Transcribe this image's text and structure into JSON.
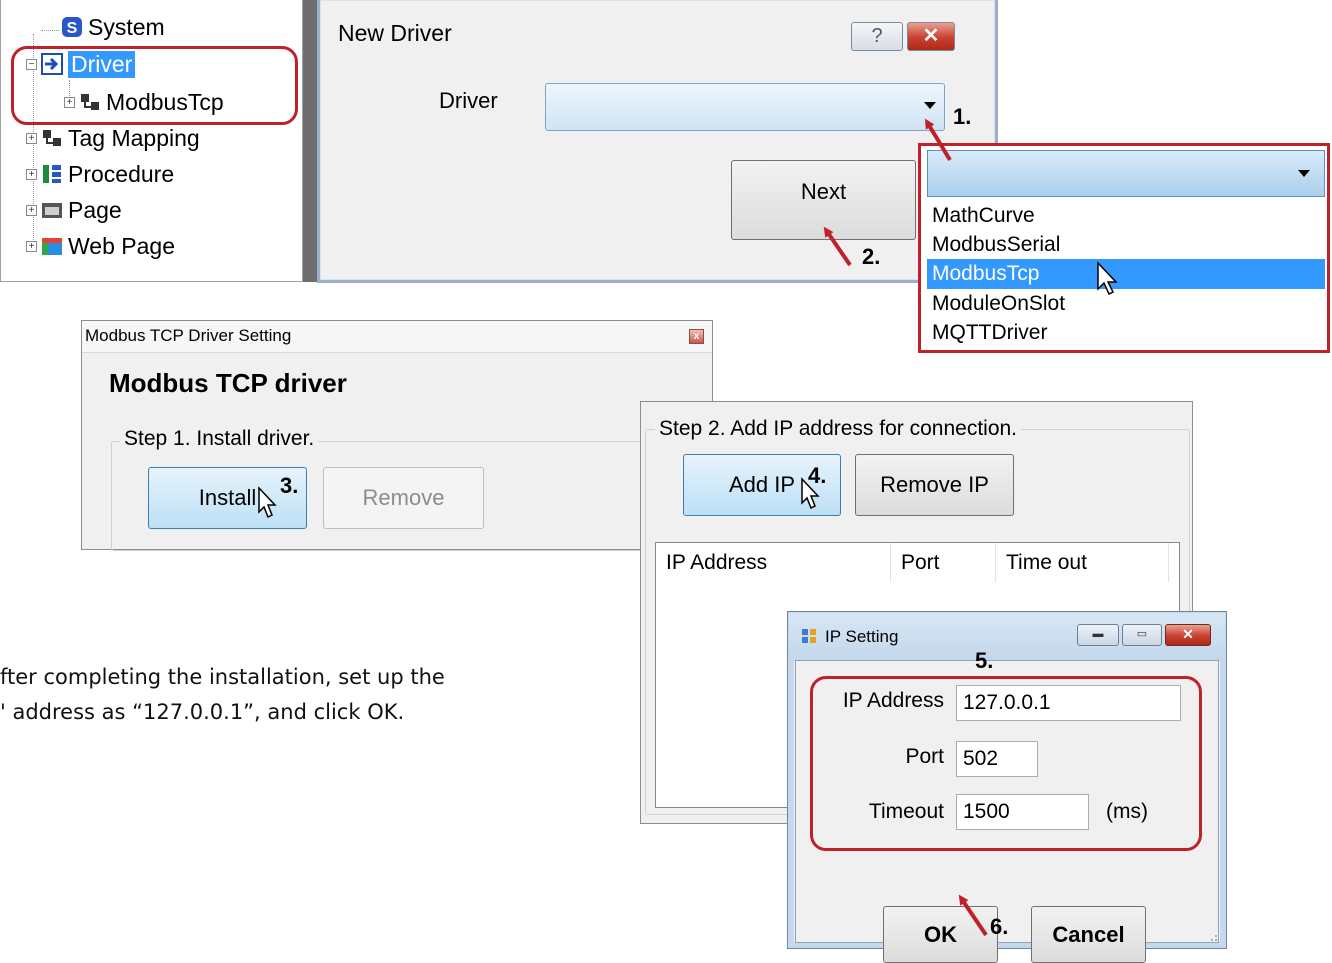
{
  "tree": {
    "items": [
      {
        "label": "System",
        "icon": "system-s-icon"
      },
      {
        "label": "Driver",
        "icon": "arrow-right-icon",
        "selected": true
      },
      {
        "label": "ModbusTcp",
        "icon": "driver-module-icon"
      },
      {
        "label": "Tag Mapping",
        "icon": "driver-module-icon"
      },
      {
        "label": "Procedure",
        "icon": "procedure-icon"
      },
      {
        "label": "Page",
        "icon": "page-icon"
      },
      {
        "label": "Web Page",
        "icon": "web-page-icon"
      }
    ]
  },
  "new_driver": {
    "title": "New Driver",
    "help_label": "?",
    "close_label": "✕",
    "driver_label": "Driver",
    "driver_value": "",
    "next_label": "Next"
  },
  "dropdown": {
    "selected_value": "",
    "options": [
      "MathCurve",
      "ModbusSerial",
      "ModbusTcp",
      "ModuleOnSlot",
      "MQTTDriver"
    ],
    "highlighted": "ModbusTcp"
  },
  "modbus_setting": {
    "title": "Modbus TCP Driver Setting",
    "heading": "Modbus TCP driver",
    "step1_label": "Step 1. Install driver.",
    "install_label": "Install",
    "remove_label": "Remove"
  },
  "step2": {
    "label": "Step 2. Add IP address for connection.",
    "add_ip_label": "Add IP",
    "remove_ip_label": "Remove IP",
    "columns": [
      "IP Address",
      "Port",
      "Time out"
    ]
  },
  "ip_setting": {
    "title": "IP Setting",
    "ip_label": "IP Address",
    "ip_value": "127.0.0.1",
    "port_label": "Port",
    "port_value": "502",
    "timeout_label": "Timeout",
    "timeout_value": "1500",
    "timeout_unit": "(ms)",
    "ok_label": "OK",
    "cancel_label": "Cancel"
  },
  "annotations": {
    "steps": [
      "1.",
      "2.",
      "3.",
      "4.",
      "5.",
      "6."
    ],
    "caption_line1": "fter completing the installation, set up the",
    "caption_line2": "' address as “127.0.0.1”, and click OK.",
    "highlight_color": "#c0202a"
  }
}
